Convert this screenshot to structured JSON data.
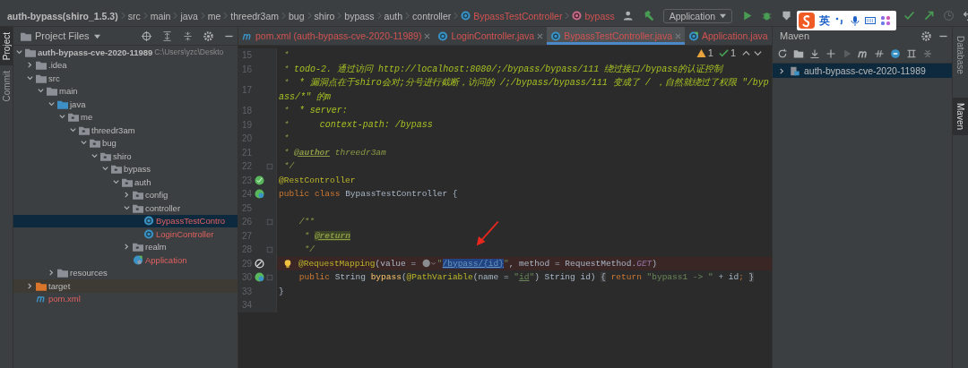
{
  "breadcrumb": [
    {
      "label": "auth-bypass(shiro_1.5.3)",
      "kind": "project"
    },
    {
      "label": "src",
      "kind": "dir"
    },
    {
      "label": "main",
      "kind": "dir"
    },
    {
      "label": "java",
      "kind": "dir"
    },
    {
      "label": "me",
      "kind": "dir"
    },
    {
      "label": "threedr3am",
      "kind": "dir"
    },
    {
      "label": "bug",
      "kind": "dir"
    },
    {
      "label": "shiro",
      "kind": "dir"
    },
    {
      "label": "bypass",
      "kind": "dir"
    },
    {
      "label": "auth",
      "kind": "dir"
    },
    {
      "label": "controller",
      "kind": "dir"
    },
    {
      "label": "BypassTestController",
      "kind": "class"
    },
    {
      "label": "bypass",
      "kind": "method"
    }
  ],
  "run_config": {
    "label": "Application"
  },
  "ime": {
    "label": "英"
  },
  "left_strip": [
    {
      "label": "Project",
      "selected": true
    },
    {
      "label": "Commit",
      "selected": false
    }
  ],
  "right_strip": [
    {
      "label": "Database",
      "selected": false
    },
    {
      "label": "Maven",
      "selected": true
    }
  ],
  "project_panel": {
    "title": "Project Files"
  },
  "tree": [
    {
      "name": "auth-bypass-cve-2020-11989",
      "path": "C:\\Users\\yzc\\Deskto",
      "kind": "module",
      "expanded": true,
      "selected": false,
      "unversioned": false,
      "children": [
        {
          "name": ".idea",
          "kind": "folder",
          "expanded": false,
          "selected": false,
          "unversioned": false
        },
        {
          "name": "src",
          "kind": "folder",
          "expanded": true,
          "selected": false,
          "unversioned": false,
          "children": [
            {
              "name": "main",
              "kind": "folder",
              "expanded": true,
              "selected": false,
              "unversioned": false,
              "children": [
                {
                  "name": "java",
                  "kind": "source",
                  "expanded": true,
                  "selected": false,
                  "unversioned": false,
                  "children": [
                    {
                      "name": "me",
                      "kind": "package",
                      "expanded": true,
                      "selected": false,
                      "unversioned": false,
                      "children": [
                        {
                          "name": "threedr3am",
                          "kind": "package",
                          "expanded": true,
                          "selected": false,
                          "unversioned": false,
                          "children": [
                            {
                              "name": "bug",
                              "kind": "package",
                              "expanded": true,
                              "selected": false,
                              "unversioned": false,
                              "children": [
                                {
                                  "name": "shiro",
                                  "kind": "package",
                                  "expanded": true,
                                  "selected": false,
                                  "unversioned": false,
                                  "children": [
                                    {
                                      "name": "bypass",
                                      "kind": "package",
                                      "expanded": true,
                                      "selected": false,
                                      "unversioned": false,
                                      "children": [
                                        {
                                          "name": "auth",
                                          "kind": "package",
                                          "expanded": true,
                                          "selected": false,
                                          "unversioned": false,
                                          "children": [
                                            {
                                              "name": "config",
                                              "kind": "package",
                                              "expanded": false,
                                              "selected": false,
                                              "unversioned": false
                                            },
                                            {
                                              "name": "controller",
                                              "kind": "package",
                                              "expanded": true,
                                              "selected": false,
                                              "unversioned": false,
                                              "children": [
                                                {
                                                  "name": "BypassTestContro",
                                                  "kind": "class",
                                                  "selected": true,
                                                  "unversioned": true
                                                },
                                                {
                                                  "name": "LoginController",
                                                  "kind": "class",
                                                  "selected": false,
                                                  "unversioned": true
                                                }
                                              ]
                                            },
                                            {
                                              "name": "realm",
                                              "kind": "package",
                                              "expanded": false,
                                              "selected": false,
                                              "unversioned": false
                                            },
                                            {
                                              "name": "Application",
                                              "kind": "app",
                                              "selected": false,
                                              "unversioned": true
                                            }
                                          ]
                                        }
                                      ]
                                    }
                                  ]
                                }
                              ]
                            }
                          ]
                        }
                      ]
                    }
                  ]
                },
                {
                  "name": "resources",
                  "kind": "resources",
                  "expanded": false,
                  "selected": false,
                  "unversioned": false
                }
              ]
            }
          ]
        },
        {
          "name": "target",
          "kind": "excluded",
          "expanded": false,
          "selected": false,
          "unversioned": false
        },
        {
          "name": "pom.xml",
          "kind": "maven",
          "selected": false,
          "unversioned": true
        }
      ]
    }
  ],
  "tabs": [
    {
      "label": "pom.xml (auth-bypass-cve-2020-11989)",
      "kind": "maven",
      "selected": false
    },
    {
      "label": "LoginController.java",
      "kind": "class",
      "selected": false
    },
    {
      "label": "BypassTestController.java",
      "kind": "class",
      "selected": true
    },
    {
      "label": "Application.java",
      "kind": "app",
      "selected": false
    }
  ],
  "inspections": [
    {
      "kind": "warning",
      "count": "1"
    },
    {
      "kind": "ok",
      "count": "1"
    }
  ],
  "code": [
    {
      "number": "15",
      "kind": "plain",
      "segments": [
        {
          "kind": "doc",
          "text": " *"
        }
      ]
    },
    {
      "number": "16",
      "kind": "plain",
      "segments": [
        {
          "kind": "doc",
          "text": " * "
        },
        {
          "kind": "todo",
          "text": "todo-2. 通过访问 http://localhost:8080/;/bypass/bypass/111 绕过接口/bypass的认证控制"
        }
      ]
    },
    {
      "number": "17",
      "kind": "plain",
      "segments": [
        {
          "kind": "doc",
          "text": " *  "
        },
        {
          "kind": "todo",
          "text": "* 漏洞点在于shiro会对;分号进行截断，访问的 /;/bypass/bypass/111 变成了 / ，自然就绕过了权限 \"/bypass/*\" 的m"
        }
      ]
    },
    {
      "number": "18",
      "kind": "plain",
      "segments": [
        {
          "kind": "doc",
          "text": " *  "
        },
        {
          "kind": "todo",
          "text": "* server:"
        }
      ]
    },
    {
      "number": "19",
      "kind": "plain",
      "segments": [
        {
          "kind": "doc",
          "text": " *      "
        },
        {
          "kind": "todo",
          "text": "context-path: /bypass"
        }
      ]
    },
    {
      "number": "20",
      "kind": "plain",
      "segments": [
        {
          "kind": "doc",
          "text": " *"
        }
      ]
    },
    {
      "number": "21",
      "kind": "plain",
      "segments": [
        {
          "kind": "doc",
          "text": " * "
        },
        {
          "kind": "doctag",
          "text": "@author"
        },
        {
          "kind": "doc",
          "text": " threedr3am"
        }
      ]
    },
    {
      "number": "22",
      "kind": "plain",
      "fold": true,
      "segments": [
        {
          "kind": "doc",
          "text": " */"
        }
      ]
    },
    {
      "number": "23",
      "kind": "bean",
      "segments": [
        {
          "kind": "annotation",
          "text": "@RestController"
        }
      ]
    },
    {
      "number": "24",
      "kind": "globe",
      "segments": [
        {
          "kind": "keyword",
          "text": "public class "
        },
        {
          "kind": "plain",
          "text": "BypassTestController {"
        }
      ]
    },
    {
      "number": "25",
      "kind": "plain"
    },
    {
      "number": "26",
      "kind": "plain",
      "fold": true,
      "segments": [
        {
          "kind": "doc",
          "text": "    /**"
        }
      ]
    },
    {
      "number": "27",
      "kind": "plain",
      "segments": [
        {
          "kind": "doc",
          "text": "     * "
        },
        {
          "kind": "doctag-marked",
          "text": "@return"
        }
      ]
    },
    {
      "number": "28",
      "kind": "plain",
      "fold": true,
      "segments": [
        {
          "kind": "doc",
          "text": "     */"
        }
      ]
    },
    {
      "number": "29",
      "kind": "blocked",
      "bulb": true,
      "error": true,
      "segments": [
        {
          "kind": "annotation",
          "text": "@RequestMapping"
        },
        {
          "kind": "plain",
          "text": "(value = "
        },
        {
          "kind": "icon"
        },
        {
          "kind": "string",
          "text": "\""
        },
        {
          "kind": "selection",
          "text": "/bypass/{id}"
        },
        {
          "kind": "string",
          "text": "\""
        },
        {
          "kind": "plain",
          "text": ", method = RequestMethod."
        },
        {
          "kind": "const",
          "text": "GET"
        },
        {
          "kind": "plain",
          "text": ")"
        }
      ]
    },
    {
      "number": "30",
      "kind": "globe",
      "fold": true,
      "segments": [
        {
          "kind": "keyword",
          "text": "    public "
        },
        {
          "kind": "plain",
          "text": "String "
        },
        {
          "kind": "fn",
          "text": "bypass"
        },
        {
          "kind": "plain",
          "text": "("
        },
        {
          "kind": "annotation",
          "text": "@PathVariable"
        },
        {
          "kind": "plain",
          "text": "(name = "
        },
        {
          "kind": "string",
          "text": "\""
        },
        {
          "kind": "link",
          "text": "id"
        },
        {
          "kind": "string",
          "text": "\""
        },
        {
          "kind": "plain",
          "text": ") String id) "
        },
        {
          "kind": "folded",
          "text": "{"
        },
        {
          "kind": "keyword",
          "text": " return "
        },
        {
          "kind": "string",
          "text": "\"bypass1 -> \""
        },
        {
          "kind": "plain",
          "text": " + id"
        },
        {
          "kind": "keyword",
          "text": "; "
        },
        {
          "kind": "folded",
          "text": "}"
        }
      ]
    },
    {
      "number": "33",
      "kind": "plain",
      "segments": [
        {
          "kind": "plain",
          "text": "}"
        }
      ]
    },
    {
      "number": "34",
      "kind": "plain"
    }
  ],
  "maven": {
    "title": "Maven",
    "items": [
      {
        "name": "auth-bypass-cve-2020-11989",
        "selected": true,
        "expanded": false
      }
    ]
  }
}
